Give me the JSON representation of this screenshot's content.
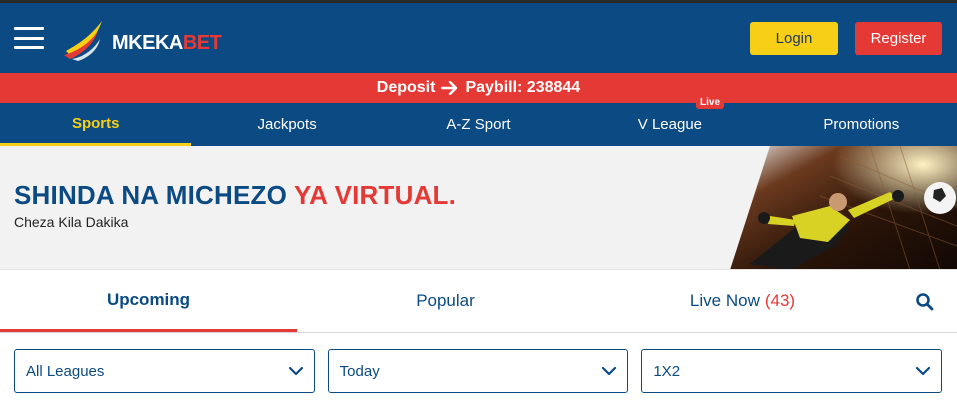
{
  "header": {
    "logo_text_main": "MKEKA",
    "logo_text_accent": "BET",
    "login_label": "Login",
    "register_label": "Register"
  },
  "deposit": {
    "label": "Deposit",
    "paybill": "Paybill: 238844"
  },
  "nav": {
    "items": [
      {
        "label": "Sports"
      },
      {
        "label": "Jackpots"
      },
      {
        "label": "A-Z Sport"
      },
      {
        "label": "V League",
        "badge": "Live"
      },
      {
        "label": "Promotions"
      }
    ]
  },
  "banner": {
    "title_main": "SHINDA NA MICHEZO ",
    "title_accent": "YA VIRTUAL.",
    "subtitle": "Cheza Kila Dakika"
  },
  "tabs": {
    "items": [
      {
        "label": "Upcoming"
      },
      {
        "label": "Popular"
      },
      {
        "label": "Live Now",
        "count": "(43)"
      }
    ]
  },
  "filters": {
    "league": "All Leagues",
    "date": "Today",
    "market": "1X2"
  },
  "colors": {
    "brand_blue": "#0b4a82",
    "brand_red": "#e53935",
    "brand_yellow": "#f7cf16"
  },
  "icons": [
    "menu-icon",
    "logo-swoosh-icon",
    "arrow-right-icon",
    "search-icon",
    "chevron-down-icon"
  ]
}
